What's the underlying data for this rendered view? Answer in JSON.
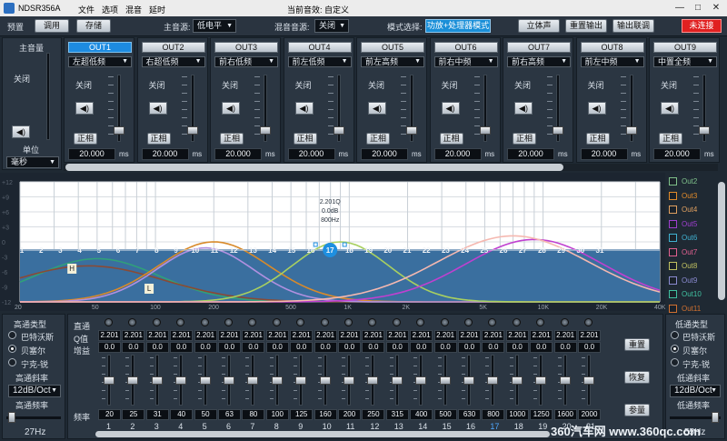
{
  "titlebar": {
    "app": "NDSR356A",
    "menus": [
      "文件",
      "选项",
      "混音",
      "延时"
    ],
    "caption": "当前音效: 自定义",
    "min": "—",
    "max": "□",
    "close": "✕"
  },
  "toolbar": {
    "preset": "预置",
    "call": "调用",
    "save": "存储",
    "main_source_label": "主音源:",
    "main_source": "低电平",
    "mix_source_label": "混音音源:",
    "mix_source": "关闭",
    "mode_label": "模式选择:",
    "mode": "功放+处理器模式",
    "stereo": "立体声",
    "reset_output": "重置输出",
    "output_link": "输出联调",
    "connection": "未连接"
  },
  "master": {
    "title": "主音量",
    "mute": "关闭",
    "speaker": "◀)",
    "unit_label": "单位",
    "unit": "毫秒",
    "level": 0.17
  },
  "outputs": [
    {
      "name": "OUT1",
      "position": "左超低频",
      "mute": "关闭",
      "phase": "正相",
      "delay": "20.000",
      "unit": "ms",
      "level": 0.14,
      "active": true
    },
    {
      "name": "OUT2",
      "position": "右超低频",
      "mute": "关闭",
      "phase": "正相",
      "delay": "20.000",
      "unit": "ms",
      "level": 0.14,
      "active": false
    },
    {
      "name": "OUT3",
      "position": "前右低频",
      "mute": "关闭",
      "phase": "正相",
      "delay": "20.000",
      "unit": "ms",
      "level": 0.14,
      "active": false
    },
    {
      "name": "OUT4",
      "position": "前左低频",
      "mute": "关闭",
      "phase": "正相",
      "delay": "20.000",
      "unit": "ms",
      "level": 0.14,
      "active": false
    },
    {
      "name": "OUT5",
      "position": "前左高频",
      "mute": "关闭",
      "phase": "正相",
      "delay": "20.000",
      "unit": "ms",
      "level": 0.14,
      "active": false
    },
    {
      "name": "OUT6",
      "position": "前右中频",
      "mute": "关闭",
      "phase": "正相",
      "delay": "20.000",
      "unit": "ms",
      "level": 0.14,
      "active": false
    },
    {
      "name": "OUT7",
      "position": "前右高频",
      "mute": "关闭",
      "phase": "正相",
      "delay": "20.000",
      "unit": "ms",
      "level": 0.14,
      "active": false
    },
    {
      "name": "OUT8",
      "position": "前左中频",
      "mute": "关闭",
      "phase": "正相",
      "delay": "20.000",
      "unit": "ms",
      "level": 0.14,
      "active": false
    },
    {
      "name": "OUT9",
      "position": "中置全频",
      "mute": "关闭",
      "phase": "正相",
      "delay": "20.000",
      "unit": "ms",
      "level": 0.14,
      "active": false
    }
  ],
  "graph": {
    "y_ticks": [
      "+12",
      "+9",
      "+6",
      "+3",
      "0",
      "-3",
      "-6",
      "-9",
      "-12"
    ],
    "x_ticks": [
      "20",
      "50",
      "100",
      "200",
      "500",
      "1K",
      "2K",
      "5K",
      "10K",
      "20K",
      "40K"
    ],
    "selected_info": [
      "2.201Q",
      "0.0dB",
      "800Hz"
    ],
    "markers": [
      "1",
      "2",
      "3",
      "4",
      "5",
      "6",
      "7",
      "8",
      "9",
      "10",
      "11",
      "12",
      "13",
      "14",
      "15",
      "16",
      "17",
      "18",
      "19",
      "20",
      "21",
      "22",
      "23",
      "24",
      "25",
      "26",
      "27",
      "28",
      "29",
      "30",
      "31"
    ],
    "selected_marker": "17",
    "hp_label": "H",
    "lp_label": "L",
    "colors": {
      "bg": "#ffffff",
      "flat": "#3a6f9f",
      "out1": "#30a07a",
      "out2": "#8a4a35",
      "out3": "#d88a2a",
      "out4": "#b090e0",
      "out5": "#a8d060",
      "out6": "#c040d0",
      "out7": "#f5b8b0"
    }
  },
  "legend": [
    {
      "label": "Out2",
      "color": "#7fc08a"
    },
    {
      "label": "Out3",
      "color": "#e08a2a"
    },
    {
      "label": "Out4",
      "color": "#e0a060"
    },
    {
      "label": "Out5",
      "color": "#9f3fd0"
    },
    {
      "label": "Out6",
      "color": "#40b0d0"
    },
    {
      "label": "Out7",
      "color": "#e06090"
    },
    {
      "label": "Out8",
      "color": "#c0c060"
    },
    {
      "label": "Out9",
      "color": "#8a8ad0"
    },
    {
      "label": "Out10",
      "color": "#40c0a0"
    },
    {
      "label": "Out11",
      "color": "#d07030"
    }
  ],
  "highpass": {
    "title": "高通类型",
    "options": [
      "巴特沃斯",
      "贝塞尔",
      "宁克-锐"
    ],
    "selected": 1,
    "slope_label": "高通斜率",
    "slope": "12dB/Oct",
    "freq_label": "高通频率",
    "freq": "27Hz",
    "level": 0.04
  },
  "lowpass": {
    "title": "低通类型",
    "options": [
      "巴特沃斯",
      "贝塞尔",
      "宁克-锐"
    ],
    "selected": 1,
    "slope_label": "低通斜率",
    "slope": "12dB/Oct",
    "freq_label": "低通频率",
    "freq": "55Hz",
    "level": 0.96
  },
  "eq": {
    "row_labels": {
      "bypass": "直通",
      "q": "Q值",
      "gain": "增益",
      "freq": "频率"
    },
    "bands": [
      {
        "q": "2.201",
        "gain": "0.0",
        "freq": "20",
        "n": "1"
      },
      {
        "q": "2.201",
        "gain": "0.0",
        "freq": "25",
        "n": "2"
      },
      {
        "q": "2.201",
        "gain": "0.0",
        "freq": "31",
        "n": "3"
      },
      {
        "q": "2.201",
        "gain": "0.0",
        "freq": "40",
        "n": "4"
      },
      {
        "q": "2.201",
        "gain": "0.0",
        "freq": "50",
        "n": "5"
      },
      {
        "q": "2.201",
        "gain": "0.0",
        "freq": "63",
        "n": "6"
      },
      {
        "q": "2.201",
        "gain": "0.0",
        "freq": "80",
        "n": "7"
      },
      {
        "q": "2.201",
        "gain": "0.0",
        "freq": "100",
        "n": "8"
      },
      {
        "q": "2.201",
        "gain": "0.0",
        "freq": "125",
        "n": "9"
      },
      {
        "q": "2.201",
        "gain": "0.0",
        "freq": "160",
        "n": "10"
      },
      {
        "q": "2.201",
        "gain": "0.0",
        "freq": "200",
        "n": "11"
      },
      {
        "q": "2.201",
        "gain": "0.0",
        "freq": "250",
        "n": "12"
      },
      {
        "q": "2.201",
        "gain": "0.0",
        "freq": "315",
        "n": "13"
      },
      {
        "q": "2.201",
        "gain": "0.0",
        "freq": "400",
        "n": "14"
      },
      {
        "q": "2.201",
        "gain": "0.0",
        "freq": "500",
        "n": "15"
      },
      {
        "q": "2.201",
        "gain": "0.0",
        "freq": "630",
        "n": "16"
      },
      {
        "q": "2.201",
        "gain": "0.0",
        "freq": "800",
        "n": "17"
      },
      {
        "q": "2.201",
        "gain": "0.0",
        "freq": "1000",
        "n": "18"
      },
      {
        "q": "2.201",
        "gain": "0.0",
        "freq": "1250",
        "n": "19"
      },
      {
        "q": "2.201",
        "gain": "0.0",
        "freq": "1600",
        "n": "20"
      },
      {
        "q": "2.201",
        "gain": "0.0",
        "freq": "2000",
        "n": "21"
      }
    ],
    "selected_band": "17",
    "reset": "重置",
    "restore": "恢复",
    "params": "参量"
  },
  "watermark": "360汽车网 www.360qc.com"
}
